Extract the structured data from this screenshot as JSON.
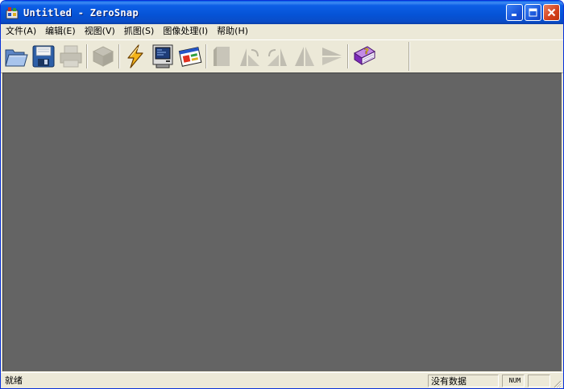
{
  "window": {
    "title": "Untitled - ZeroSnap"
  },
  "menu": {
    "items": [
      {
        "label": "文件(A)"
      },
      {
        "label": "编辑(E)"
      },
      {
        "label": "视图(V)"
      },
      {
        "label": "抓图(S)"
      },
      {
        "label": "图像处理(I)"
      },
      {
        "label": "帮助(H)"
      }
    ]
  },
  "toolbar": {
    "buttons": [
      {
        "icon": "open-folder-icon",
        "enabled": true
      },
      {
        "icon": "save-disk-icon",
        "enabled": true
      },
      {
        "icon": "print-icon",
        "enabled": false
      },
      {
        "icon": "copy-icon",
        "enabled": false
      },
      {
        "icon": "lightning-capture-icon",
        "enabled": true
      },
      {
        "icon": "screen-monitor-icon",
        "enabled": true
      },
      {
        "icon": "window-capture-icon",
        "enabled": true
      },
      {
        "icon": "crop-icon",
        "enabled": false
      },
      {
        "icon": "rotate-left-icon",
        "enabled": false
      },
      {
        "icon": "rotate-right-icon",
        "enabled": false
      },
      {
        "icon": "flip-horizontal-icon",
        "enabled": false
      },
      {
        "icon": "flip-vertical-icon",
        "enabled": false
      },
      {
        "icon": "help-book-icon",
        "enabled": true
      }
    ]
  },
  "status": {
    "message": "就绪",
    "info": "没有数据",
    "indicator": "NUM"
  },
  "colors": {
    "title_bar": "#0a5ee8",
    "workspace": "#646464",
    "chrome": "#ece9d8"
  }
}
